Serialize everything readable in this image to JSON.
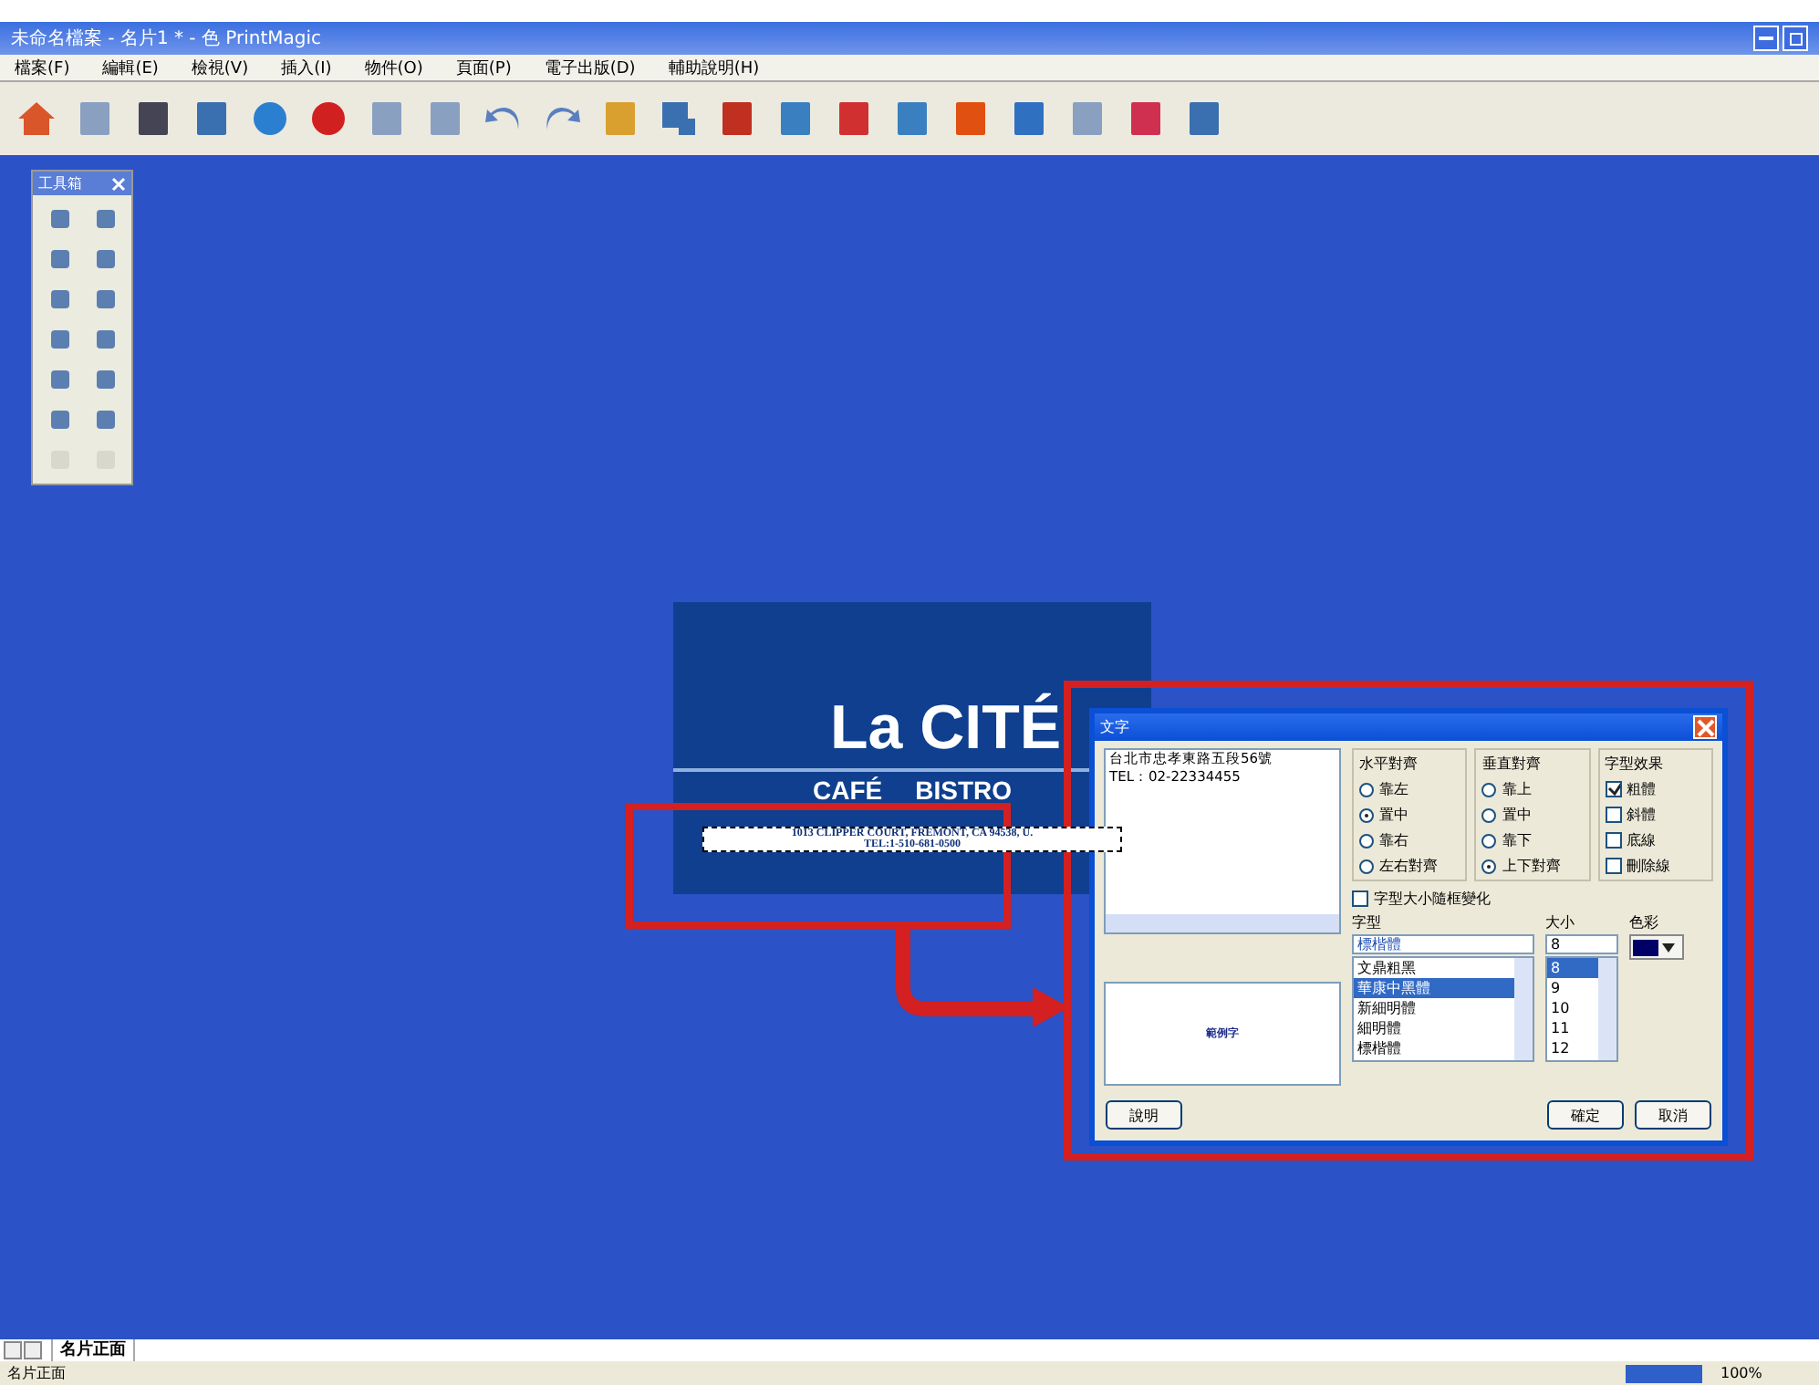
{
  "window": {
    "title": "未命名檔案 - 名片1 * - 色 PrintMagic"
  },
  "menu": [
    "檔案(F)",
    "編輯(E)",
    "檢視(V)",
    "插入(I)",
    "物件(O)",
    "頁面(P)",
    "電子出版(D)",
    "輔助說明(H)"
  ],
  "toolbox": {
    "title": "工具箱"
  },
  "card": {
    "name": "La CITÉ",
    "subtitle": [
      "CAFÉ",
      "BISTRO"
    ],
    "address": "1013 CLIPPER COURT, FREMONT, CA 94538, U.",
    "phone": "TEL:1-510-681-0500"
  },
  "dialog": {
    "title": "文字",
    "text_lines": [
      "台北市忠孝東路五段56號",
      "TEL：02-22334455"
    ],
    "groups": [
      {
        "title": "水平對齊",
        "kind": "radio",
        "options": [
          {
            "label": "靠左",
            "selected": false
          },
          {
            "label": "置中",
            "selected": true
          },
          {
            "label": "靠右",
            "selected": false
          },
          {
            "label": "左右對齊",
            "selected": false
          }
        ]
      },
      {
        "title": "垂直對齊",
        "kind": "radio",
        "options": [
          {
            "label": "靠上",
            "selected": false
          },
          {
            "label": "置中",
            "selected": false
          },
          {
            "label": "靠下",
            "selected": false
          },
          {
            "label": "上下對齊",
            "selected": true
          }
        ]
      },
      {
        "title": "字型效果",
        "kind": "check",
        "options": [
          {
            "label": "粗體",
            "checked": true
          },
          {
            "label": "斜體",
            "checked": false
          },
          {
            "label": "底線",
            "checked": false
          },
          {
            "label": "刪除線",
            "checked": false
          }
        ]
      }
    ],
    "autosize": {
      "label": "字型大小隨框變化",
      "checked": false
    },
    "font_label": "字型",
    "font_value": "標楷體",
    "fonts": [
      {
        "label": "文鼎粗黑",
        "selected": false
      },
      {
        "label": "華康中黑體",
        "selected": true
      },
      {
        "label": "新細明體",
        "selected": false
      },
      {
        "label": "細明體",
        "selected": false
      },
      {
        "label": "標楷體",
        "selected": false
      }
    ],
    "size_label": "大小",
    "size_value": "8",
    "sizes": [
      {
        "label": "8",
        "selected": true
      },
      {
        "label": "9",
        "selected": false
      },
      {
        "label": "10",
        "selected": false
      },
      {
        "label": "11",
        "selected": false
      },
      {
        "label": "12",
        "selected": false
      }
    ],
    "color_label": "色彩",
    "color": "#000066",
    "preview": "範例字",
    "buttons": [
      "說明",
      "確定",
      "取消"
    ]
  },
  "sheet_tabs": [
    {
      "label": "名片正面",
      "selected": true
    }
  ],
  "status_bar": {
    "page": "名片正面",
    "zoom": "100%"
  }
}
